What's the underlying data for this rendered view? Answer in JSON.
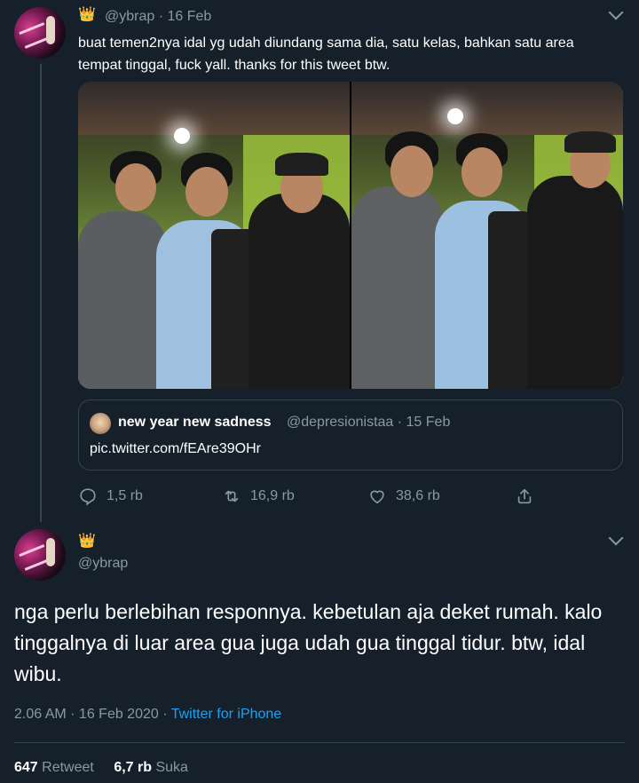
{
  "tweet1": {
    "handle_line": "@ybrap · 16 Feb",
    "text": "buat temen2nya idal yg udah diundang sama dia, satu kelas, bahkan satu area tempat tinggal, fuck yall. thanks for this tweet btw.",
    "quoted": {
      "name": "new year new sadness",
      "handle_date": "@depresionistaa · 15 Feb",
      "link": "pic.twitter.com/fEAre39OHr"
    },
    "actions": {
      "reply_count": "1,5 rb",
      "retweet_count": "16,9 rb",
      "like_count": "38,6 rb"
    }
  },
  "tweet2": {
    "handle": "@ybrap",
    "text": "nga perlu berlebihan responnya. kebetulan aja deket rumah. kalo tinggalnya di luar area gua juga udah gua tinggal tidur. btw, idal wibu.",
    "time": "2.06 AM · 16 Feb 2020 · ",
    "source": "Twitter for iPhone",
    "retweets_count": "647",
    "retweets_label": "Retweet",
    "likes_count": "6,7 rb",
    "likes_label": "Suka"
  },
  "icons": {
    "crown": "👑",
    "reply": "reply-icon",
    "retweet": "retweet-icon",
    "like": "like-icon",
    "share": "share-icon",
    "chevron": "chevron-down-icon"
  },
  "colors": {
    "background": "#15202b",
    "secondary_text": "#8899a6",
    "accent": "#1da1f2",
    "border": "#38444d"
  }
}
